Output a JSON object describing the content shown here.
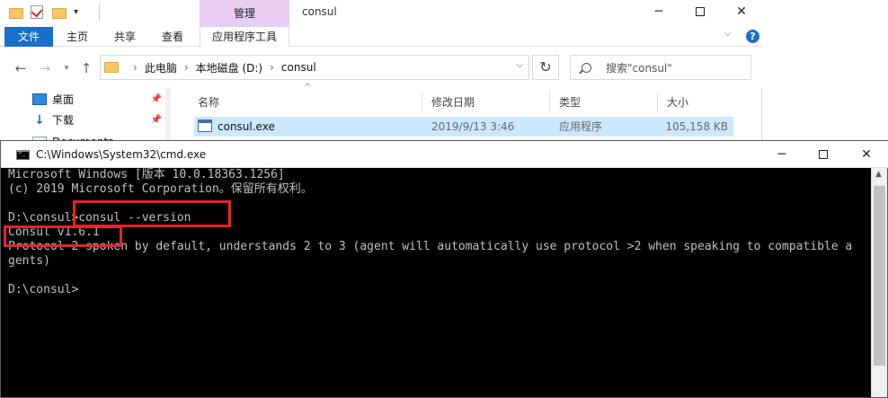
{
  "explorer": {
    "title": "consul",
    "context_tab_top": "管理",
    "ribbon_tabs": [
      "文件",
      "主页",
      "共享",
      "查看",
      "应用程序工具"
    ],
    "address_crumbs": [
      "此电脑",
      "本地磁盘 (D:)",
      "consul"
    ],
    "search_placeholder": "搜索\"consul\"",
    "nav_items": [
      "桌面",
      "下载",
      "Documents"
    ],
    "columns": [
      "名称",
      "修改日期",
      "类型",
      "大小"
    ],
    "files": [
      {
        "name": "consul.exe",
        "date": "2019/9/13 3:46",
        "type": "应用程序",
        "size": "105,158 KB"
      }
    ]
  },
  "cmd": {
    "title": "C:\\Windows\\System32\\cmd.exe",
    "lines": [
      "Microsoft Windows [版本 10.0.18363.1256]",
      "(c) 2019 Microsoft Corporation。保留所有权利。",
      "",
      "D:\\consul>consul --version",
      "Consul v1.6.1",
      "Protocol 2 spoken by default, understands 2 to 3 (agent will automatically use protocol >2 when speaking to compatible a",
      "gents)",
      "",
      "D:\\consul>"
    ]
  },
  "colors": {
    "file_tab": "#1a6fc9",
    "context_tab": "#e8cdf3",
    "selection": "#cce8ff",
    "highlight_box": "#e8232a",
    "console_bg": "#000000",
    "console_text": "#c0c0c0"
  }
}
